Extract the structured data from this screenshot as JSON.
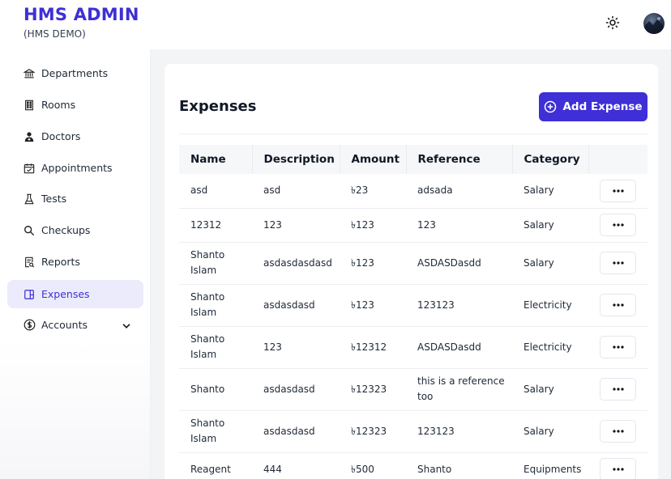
{
  "header": {
    "title": "HMS ADMIN",
    "subtitle": "(HMS DEMO)",
    "theme_icon": "sun-icon",
    "avatar_icon": "user-avatar"
  },
  "sidebar": {
    "items": [
      {
        "label": "Departments",
        "icon": "bank-icon"
      },
      {
        "label": "Rooms",
        "icon": "building-icon"
      },
      {
        "label": "Doctors",
        "icon": "doctor-icon"
      },
      {
        "label": "Appointments",
        "icon": "calendar-icon"
      },
      {
        "label": "Tests",
        "icon": "flask-icon"
      },
      {
        "label": "Checkups",
        "icon": "search-icon"
      },
      {
        "label": "Reports",
        "icon": "report-icon"
      },
      {
        "label": "Expenses",
        "icon": "expense-icon",
        "active": true
      },
      {
        "label": "Accounts",
        "icon": "dollar-circle-icon",
        "has_submenu": true
      }
    ]
  },
  "main": {
    "title": "Expenses",
    "add_button_label": "Add Expense",
    "columns": [
      "Name",
      "Description",
      "Amount",
      "Reference",
      "Category"
    ],
    "rows": [
      {
        "name": "asd",
        "description": "asd",
        "amount": "৳23",
        "reference": "adsada",
        "category": "Salary"
      },
      {
        "name": "12312",
        "description": "123",
        "amount": "৳123",
        "reference": "123",
        "category": "Salary"
      },
      {
        "name": "Shanto Islam",
        "description": "asdasdasdasd",
        "amount": "৳123",
        "reference": "ASDASDasdd",
        "category": "Salary"
      },
      {
        "name": "Shanto Islam",
        "description": "asdasdasd",
        "amount": "৳123",
        "reference": "123123",
        "category": "Electricity"
      },
      {
        "name": "Shanto Islam",
        "description": "123",
        "amount": "৳12312",
        "reference": "ASDASDasdd",
        "category": "Electricity"
      },
      {
        "name": "Shanto",
        "description": "asdasdasd",
        "amount": "৳12323",
        "reference": "this is a reference too",
        "category": "Salary"
      },
      {
        "name": "Shanto Islam",
        "description": "asdasdasd",
        "amount": "৳12323",
        "reference": "123123",
        "category": "Salary"
      },
      {
        "name": "Reagent",
        "description": "444",
        "amount": "৳500",
        "reference": "Shanto",
        "category": "Equipments"
      }
    ]
  },
  "colors": {
    "accent": "#3f2fd6",
    "active_bg": "#ecebfb",
    "content_bg": "#f3f4f6"
  }
}
